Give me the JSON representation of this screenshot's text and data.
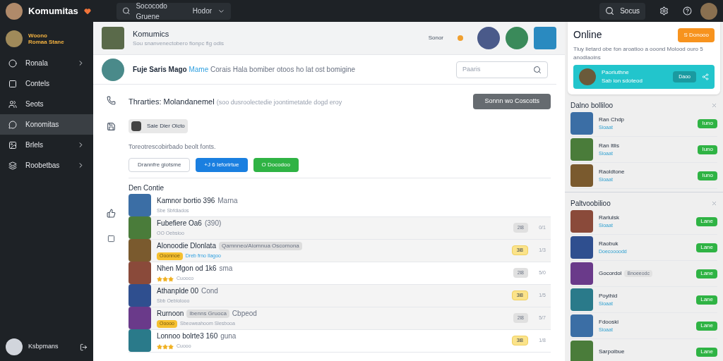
{
  "topbar": {
    "brand": "Komumitas",
    "search": {
      "placeholder": "Sococodo Gruene",
      "filter": "Hodor"
    },
    "search_button": "Socus"
  },
  "sidebar": {
    "profile": {
      "line1": "Woono",
      "line2": "Romaa Stane"
    },
    "items": [
      {
        "label": "Ronala",
        "selected": false,
        "has_arrow": true
      },
      {
        "label": "Contels",
        "selected": false,
        "has_arrow": false
      },
      {
        "label": "Seots",
        "selected": false,
        "has_arrow": false
      },
      {
        "label": "Konomitas",
        "selected": true,
        "has_arrow": false
      },
      {
        "label": "Brlels",
        "selected": false,
        "has_arrow": true
      },
      {
        "label": "Roobetbas",
        "selected": false,
        "has_arrow": true
      }
    ],
    "footer_user": "Ksbpmans"
  },
  "header": {
    "title": "Komumics",
    "subtitle": "Sou snanvenectobero fionpc flg odis",
    "status": "Sonor"
  },
  "post": {
    "author": "Fuje Saris Mago",
    "role": "Mame",
    "text": "Corais Hala bomiber otoos ho lat ost bomigine",
    "search_placeholder": "Paaris"
  },
  "thread": {
    "title": "Thrarties: Molandanemel",
    "detail": "(soo dusroolectedie joontimetatde dogd eroy",
    "button": "Sonnn wo Coscotts"
  },
  "chip": "Saie Dier Olcto",
  "note": "Toreotrescobirbado beolt fonts.",
  "actions": [
    {
      "kind": "outline",
      "label": "Drannfre giotsme"
    },
    {
      "kind": "primary",
      "label": "+J 6 Ieforirtue"
    },
    {
      "kind": "success",
      "label": "O Docodoo"
    }
  ],
  "list": {
    "heading": "Den Contie",
    "rows": [
      {
        "title": "Kamnor bortio 396",
        "suffix": "Marna",
        "subtitle": "Sbe Sbfdiados"
      },
      {
        "title": "Fubefiere Oa6",
        "suffix": "(390)",
        "subtitle": "OO Oebsioo",
        "badge": "2l8",
        "highlight": false,
        "count": "0/1"
      },
      {
        "title": "Alonoodie Dlonlata",
        "tag": "Qamnneo/Aiomnua Oscomona",
        "label": "Ooonnoe",
        "subtitle": "Dreb frno Ilagoo",
        "link": true,
        "badge": "3l8",
        "highlight": true,
        "count": "1/3"
      },
      {
        "title": "Nhen Mgon od 1k6",
        "suffix": "sma",
        "stars": 3,
        "subtitle": "Cuooco",
        "badge": "2l8",
        "highlight": false,
        "count": "5/0"
      },
      {
        "title": "Athanplde 00",
        "suffix": "Cond",
        "subtitle": "Sbb Oeblolooo",
        "badge": "3l8",
        "highlight": true,
        "count": "1/5"
      },
      {
        "title": "Rurnoon",
        "tag": "Ibenns Gruoca",
        "suffix": "Cbpeod",
        "label": "Ooooo",
        "subtitle": "Sbeoweahoom Slesbooa",
        "badge": "2l8",
        "highlight": false,
        "count": "5/7"
      },
      {
        "title": "Lonnoo bolrte3 160",
        "suffix": "guna",
        "stars": 3,
        "subtitle": "Cuooo",
        "badge": "3l8",
        "highlight": true,
        "count": "1/8"
      }
    ]
  },
  "online": {
    "title": "Online",
    "button": "S Donooo",
    "text": "Tluy lietard obe fon aroatioo a ooond Molood ouro 5 anodlaoins",
    "featured": {
      "name": "Paoriuthne",
      "sub": "Sab ion sdoteod",
      "button": "Daoo"
    }
  },
  "groups": [
    {
      "title": "Dalno bolliloo",
      "items": [
        {
          "name": "Ran Chdp",
          "sub": "Sioaat",
          "badge": "Iuno"
        },
        {
          "name": "Ran Itlis",
          "sub": "Sioaat",
          "badge": "Iuno"
        },
        {
          "name": "Raoldtone",
          "sub": "Sioaat",
          "badge": "Iuno"
        }
      ]
    },
    {
      "title": "Paltvoobilioo",
      "items": [
        {
          "name": "Rarlulsk",
          "sub": "Sioaat",
          "badge": "Lane"
        },
        {
          "name": "Raobuk",
          "sub": "Doecoooodd",
          "badge": "Lane"
        },
        {
          "name": "Gocordol",
          "tag": "Bnoeeodc",
          "badge": "Lane"
        },
        {
          "name": "Poyihid",
          "sub": "Sioaat",
          "badge": "Lane"
        },
        {
          "name": "Fdooski",
          "sub": "Sioaat",
          "badge": "Lane"
        },
        {
          "name": "Sarpoibue",
          "badge": "Lane"
        }
      ]
    }
  ]
}
